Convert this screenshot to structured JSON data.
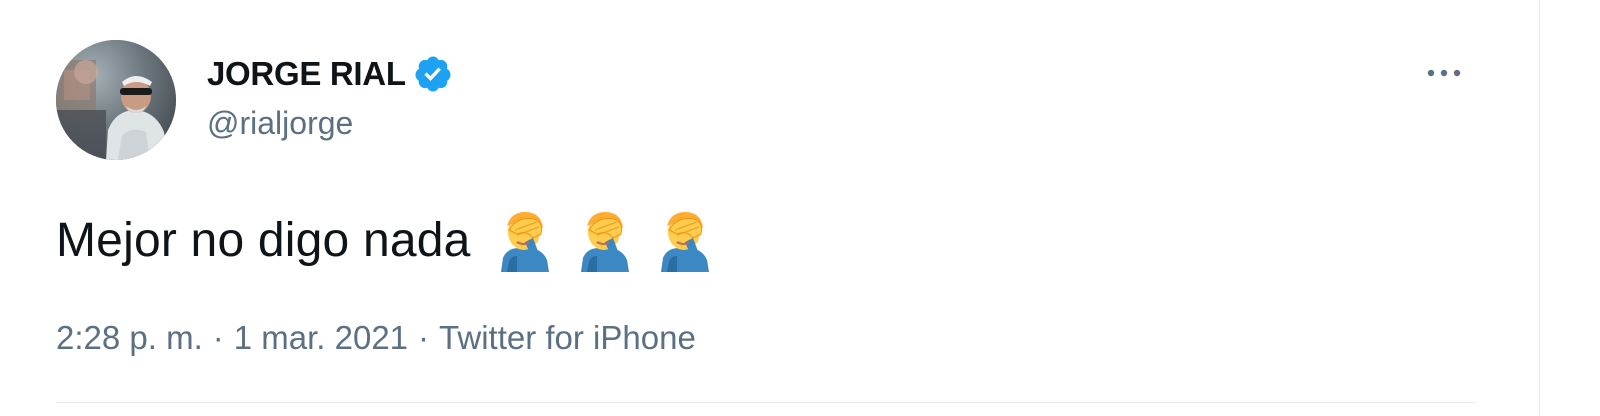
{
  "tweet": {
    "author": {
      "display_name": "JORGE RIAL",
      "handle": "@rialjorge",
      "verified": true,
      "avatar_icon": "profile-photo"
    },
    "text": "Mejor no digo nada",
    "emojis": [
      "🤦‍♂️",
      "🤦‍♂️",
      "🤦‍♂️"
    ],
    "meta": {
      "time": "2:28 p. m.",
      "separator": "·",
      "date": "1 mar. 2021",
      "source": "Twitter for iPhone"
    },
    "more_icon": "more-options-icon"
  },
  "colors": {
    "text_primary": "#0f1419",
    "text_secondary": "#5b7083",
    "verified_blue": "#1da1f2",
    "divider": "#e6ecf0"
  }
}
